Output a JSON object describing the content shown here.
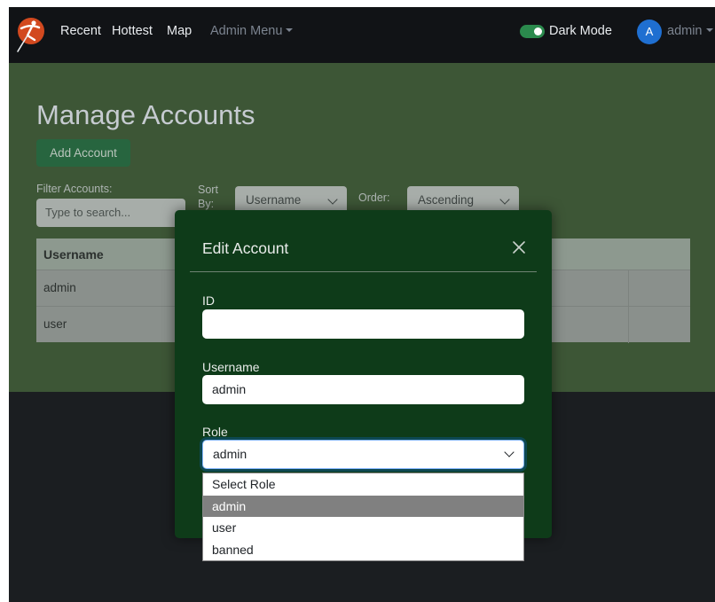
{
  "navbar": {
    "links": [
      "Recent",
      "Hottest",
      "Map"
    ],
    "admin_menu": "Admin Menu",
    "dark_mode_label": "Dark Mode",
    "dark_mode_on": true,
    "avatar_letter": "A",
    "user_name": "admin"
  },
  "page": {
    "title": "Manage Accounts",
    "add_button": "Add Account",
    "filter_label": "Filter Accounts:",
    "search_placeholder": "Type to search...",
    "sort_label": "Sort By:",
    "sort_value": "Username",
    "order_label": "Order:",
    "order_value": "Ascending"
  },
  "table": {
    "header": "Username",
    "rows": [
      "admin",
      "user"
    ]
  },
  "modal": {
    "title": "Edit Account",
    "id_label": "ID",
    "id_value": "",
    "username_label": "Username",
    "username_value": "admin",
    "role_label": "Role",
    "role_value": "admin",
    "role_options": [
      "Select Role",
      "admin",
      "user",
      "banned"
    ],
    "highlighted_option": "admin"
  },
  "colors": {
    "navbar": "#111316",
    "content_panel": "#3d5636",
    "modal": "#0e3b19",
    "toggle_on": "#2b8a4d",
    "avatar": "#1f6fd1"
  }
}
